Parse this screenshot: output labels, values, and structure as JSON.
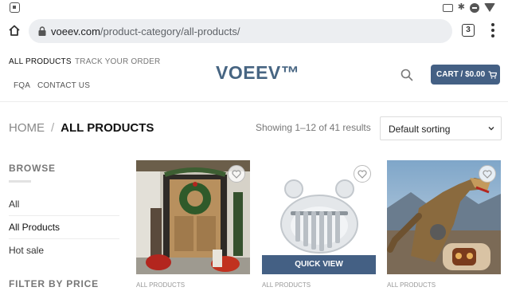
{
  "browser": {
    "url_host": "voeev.com",
    "url_path": "/product-category/all-products/",
    "tab_count": "3"
  },
  "header": {
    "nav": [
      "ALL PRODUCTS",
      "TRACK YOUR ORDER",
      "FQA",
      "CONTACT US"
    ],
    "logo": "VOEEV™",
    "cart_label": "CART / $0.00"
  },
  "breadcrumb": {
    "home": "HOME",
    "separator": "/",
    "current": "ALL PRODUCTS"
  },
  "results": {
    "count_text": "Showing 1–12 of 41 results",
    "sort_selected": "Default sorting"
  },
  "sidebar": {
    "browse_heading": "BROWSE",
    "items": [
      "All",
      "All Products",
      "Hot sale"
    ],
    "filter_heading": "FILTER BY PRICE"
  },
  "products": [
    {
      "category": "ALL PRODUCTS",
      "image": "christmas-front-door-photo"
    },
    {
      "category": "ALL PRODUCTS",
      "image": "mini-kalimba-photo",
      "quick_view": "QUICK VIEW"
    },
    {
      "category": "ALL PRODUCTS",
      "image": "robot-dinosaur-toy-photo"
    }
  ],
  "colors": {
    "brand": "#446084",
    "logo": "#476582"
  }
}
